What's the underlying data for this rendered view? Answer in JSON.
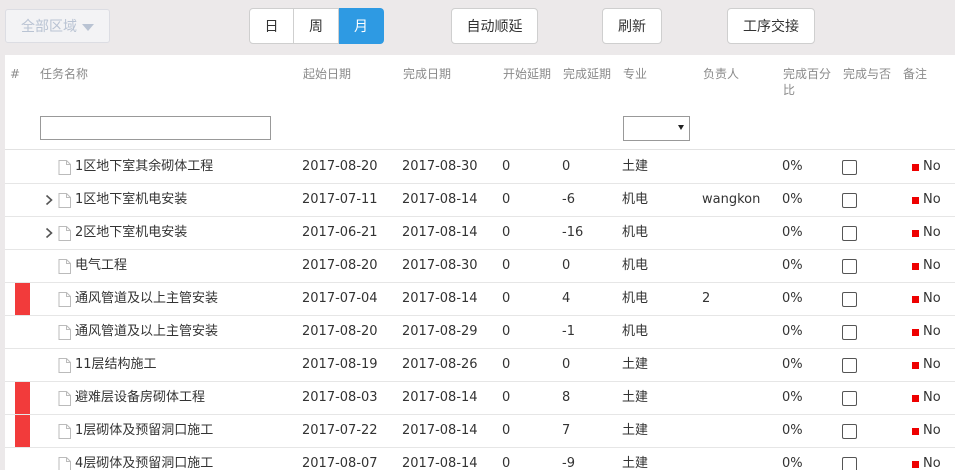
{
  "toolbar": {
    "region": "全部区域",
    "views": [
      "日",
      "周",
      "月"
    ],
    "auto_delay": "自动顺延",
    "refresh": "刷新",
    "handover": "工序交接"
  },
  "columns": [
    "#",
    "任务名称",
    "起始日期",
    "完成日期",
    "开始延期",
    "完成延期",
    "专业",
    "负责人",
    "完成百分比",
    "完成与否",
    "备注"
  ],
  "rows": [
    {
      "name": "1区地下室其余砌体工程",
      "start": "2017-08-20",
      "end": "2017-08-30",
      "start_delay": "0",
      "end_delay": "0",
      "major": "土建",
      "owner": "",
      "percent": "0%",
      "note": "No",
      "flag": false,
      "expandable": false
    },
    {
      "name": "1区地下室机电安装",
      "start": "2017-07-11",
      "end": "2017-08-14",
      "start_delay": "0",
      "end_delay": "-6",
      "major": "机电",
      "owner": "wangkon",
      "percent": "0%",
      "note": "No",
      "flag": false,
      "expandable": true
    },
    {
      "name": "2区地下室机电安装",
      "start": "2017-06-21",
      "end": "2017-08-14",
      "start_delay": "0",
      "end_delay": "-16",
      "major": "机电",
      "owner": "",
      "percent": "0%",
      "note": "No",
      "flag": false,
      "expandable": true
    },
    {
      "name": "电气工程",
      "start": "2017-08-20",
      "end": "2017-08-30",
      "start_delay": "0",
      "end_delay": "0",
      "major": "机电",
      "owner": "",
      "percent": "0%",
      "note": "No",
      "flag": false,
      "expandable": false
    },
    {
      "name": "通风管道及以上主管安装",
      "start": "2017-07-04",
      "end": "2017-08-14",
      "start_delay": "0",
      "end_delay": "4",
      "major": "机电",
      "owner": "2",
      "percent": "0%",
      "note": "No",
      "flag": true,
      "expandable": false
    },
    {
      "name": "通风管道及以上主管安装",
      "start": "2017-08-20",
      "end": "2017-08-29",
      "start_delay": "0",
      "end_delay": "-1",
      "major": "机电",
      "owner": "",
      "percent": "0%",
      "note": "No",
      "flag": false,
      "expandable": false
    },
    {
      "name": "11层结构施工",
      "start": "2017-08-19",
      "end": "2017-08-26",
      "start_delay": "0",
      "end_delay": "0",
      "major": "土建",
      "owner": "",
      "percent": "0%",
      "note": "No",
      "flag": false,
      "expandable": false
    },
    {
      "name": "避难层设备房砌体工程",
      "start": "2017-08-03",
      "end": "2017-08-14",
      "start_delay": "0",
      "end_delay": "8",
      "major": "土建",
      "owner": "",
      "percent": "0%",
      "note": "No",
      "flag": true,
      "expandable": false
    },
    {
      "name": "1层砌体及预留洞口施工",
      "start": "2017-07-22",
      "end": "2017-08-14",
      "start_delay": "0",
      "end_delay": "7",
      "major": "土建",
      "owner": "",
      "percent": "0%",
      "note": "No",
      "flag": true,
      "expandable": false
    },
    {
      "name": "4层砌体及预留洞口施工",
      "start": "2017-08-07",
      "end": "2017-08-14",
      "start_delay": "0",
      "end_delay": "-9",
      "major": "土建",
      "owner": "",
      "percent": "0%",
      "note": "No",
      "flag": false,
      "expandable": false
    }
  ],
  "colors": {
    "accent": "#2e9ae3",
    "delay_flag": "#f23b3b",
    "no_marker": "#e00000"
  }
}
